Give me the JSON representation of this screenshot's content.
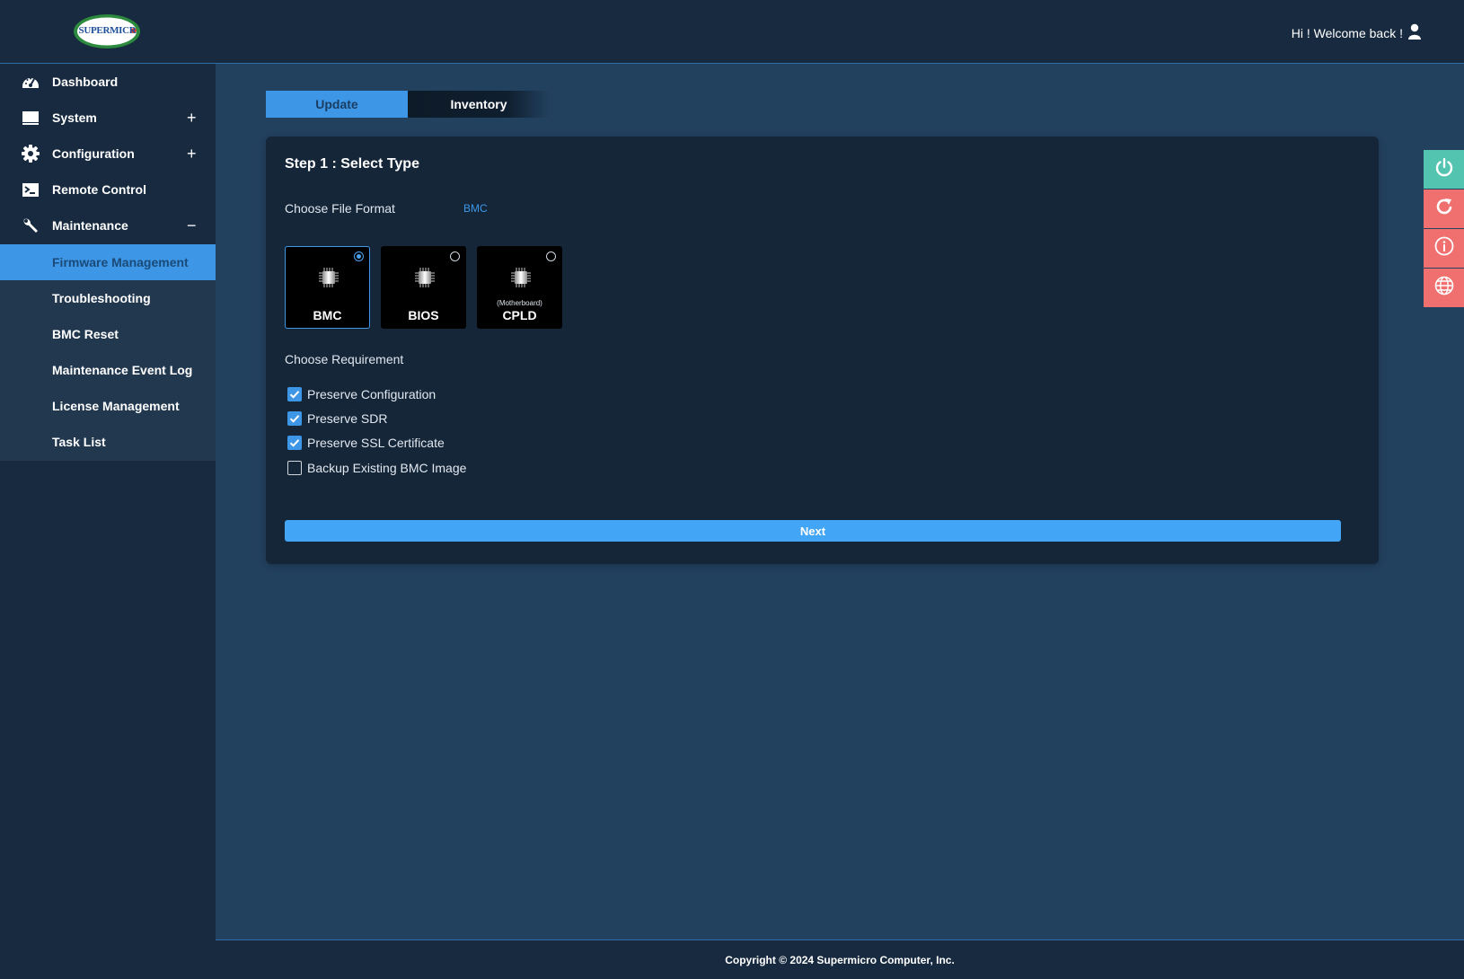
{
  "header": {
    "logo_text": "SUPERMICR",
    "welcome": "Hi ! Welcome back !",
    "user_icon": "user-icon"
  },
  "sidebar": {
    "items": [
      {
        "label": "Dashboard",
        "icon": "dashboard-icon",
        "toggle": ""
      },
      {
        "label": "System",
        "icon": "monitor-icon",
        "toggle": "+"
      },
      {
        "label": "Configuration",
        "icon": "gear-icon",
        "toggle": "+"
      },
      {
        "label": "Remote Control",
        "icon": "terminal-icon",
        "toggle": ""
      },
      {
        "label": "Maintenance",
        "icon": "wrench-icon",
        "toggle": "−"
      }
    ],
    "maintenance_submenu": [
      {
        "label": "Firmware Management",
        "active": true
      },
      {
        "label": "Troubleshooting"
      },
      {
        "label": "BMC Reset"
      },
      {
        "label": "Maintenance Event Log"
      },
      {
        "label": "License Management"
      },
      {
        "label": "Task List"
      }
    ]
  },
  "tabs": [
    {
      "label": "Update",
      "active": true
    },
    {
      "label": "Inventory",
      "active": false
    }
  ],
  "step": {
    "title": "Step 1 : Select Type",
    "file_format_label": "Choose File Format",
    "file_format_value": "BMC",
    "types": [
      {
        "label": "BMC",
        "sublabel": "",
        "selected": true
      },
      {
        "label": "BIOS",
        "sublabel": "",
        "selected": false
      },
      {
        "label": "CPLD",
        "sublabel": "(Motherboard)",
        "selected": false
      }
    ],
    "requirement_label": "Choose Requirement",
    "requirements": [
      {
        "label": "Preserve Configuration",
        "checked": true
      },
      {
        "label": "Preserve SDR",
        "checked": true
      },
      {
        "label": "Preserve SSL Certificate",
        "checked": true
      },
      {
        "label": "Backup Existing BMC Image",
        "checked": false
      }
    ],
    "next_label": "Next"
  },
  "side_actions": [
    "power-icon",
    "refresh-icon",
    "info-icon",
    "globe-icon"
  ],
  "footer": {
    "copyright": "Copyright © 2024 Supermicro Computer, Inc."
  },
  "colors": {
    "accent": "#3e97e6",
    "sidebar_bg": "#172a3f",
    "main_bg": "#22415f",
    "card_bg": "#152639",
    "power": "#52c4b0",
    "alert": "#f06f6f"
  }
}
